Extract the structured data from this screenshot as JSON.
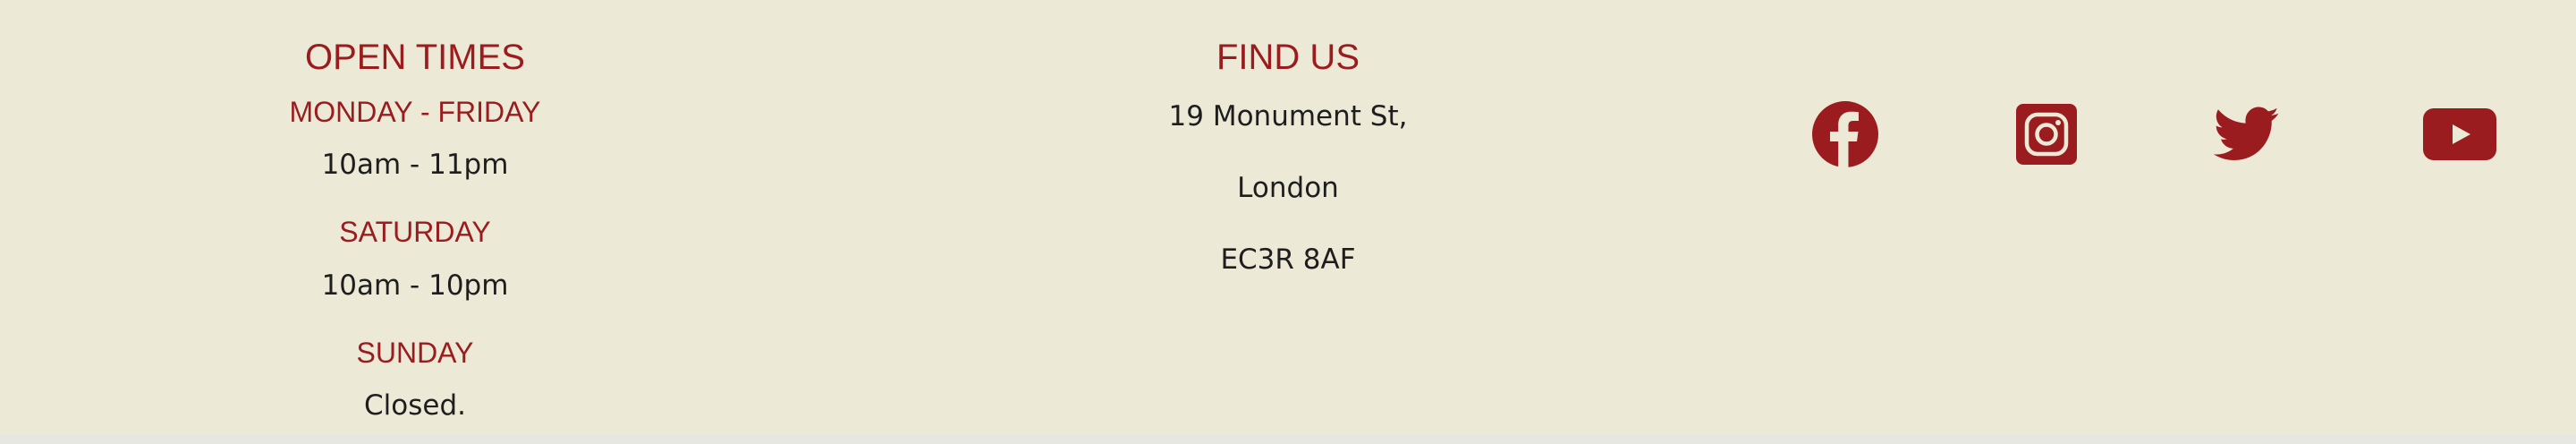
{
  "open_times": {
    "heading": "OPEN TIMES",
    "entries": [
      {
        "day": "MONDAY - FRIDAY",
        "hours": "10am - 11pm"
      },
      {
        "day": "SATURDAY",
        "hours": "10am - 10pm"
      },
      {
        "day": "SUNDAY",
        "hours": "Closed."
      }
    ]
  },
  "find_us": {
    "heading": "FIND US",
    "address": [
      "19 Monument St,",
      "London",
      "EC3R 8AF"
    ]
  },
  "social": {
    "icons": [
      "facebook-icon",
      "instagram-icon",
      "twitter-icon",
      "youtube-icon"
    ],
    "color": "#9b1c1f"
  },
  "colors": {
    "background": "#ecead6",
    "accent": "#9b1c1f",
    "text": "#1e1e1e"
  }
}
